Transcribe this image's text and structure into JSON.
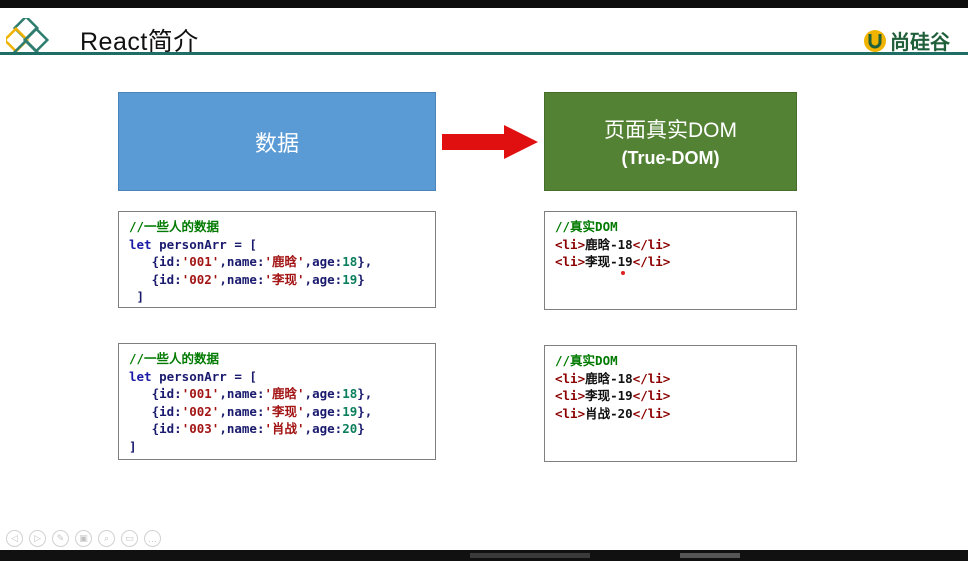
{
  "header": {
    "title": "React简介",
    "brand": "尚硅谷"
  },
  "diagram": {
    "source_label": "数据",
    "target_label_1": "页面真实DOM",
    "target_label_2": "(True-DOM)"
  },
  "code_a": {
    "comment": "//一些人的数据",
    "let": "let",
    "decl": " personArr = [",
    "rows": [
      {
        "id": "'001'",
        "name": "'鹿晗'",
        "age": "18"
      },
      {
        "id": "'002'",
        "name": "'李现'",
        "age": "19"
      }
    ],
    "close": " ]"
  },
  "code_b": {
    "comment": "//真实DOM",
    "items": [
      "鹿晗-18",
      "李现-19"
    ]
  },
  "code_c": {
    "comment": "//一些人的数据",
    "let": "let",
    "decl": " personArr = [",
    "rows": [
      {
        "id": "'001'",
        "name": "'鹿晗'",
        "age": "18"
      },
      {
        "id": "'002'",
        "name": "'李现'",
        "age": "19"
      },
      {
        "id": "'003'",
        "name": "'肖战'",
        "age": "20"
      }
    ],
    "close": "]"
  },
  "code_d": {
    "comment": "//真实DOM",
    "items": [
      "鹿晗-18",
      "李现-19",
      "肖战-20"
    ]
  },
  "syntax": {
    "indent": "   ",
    "open": "{id:",
    "name_key": ",name:",
    "age_key": ",age:",
    "row_close": "},",
    "last_close": "}",
    "li_open": "<li>",
    "li_close": "</li>"
  },
  "toolbar": {
    "buttons": [
      "◁",
      "▷",
      "✎",
      "▣",
      "⌕",
      "▭",
      "…"
    ]
  },
  "colors": {
    "header_line": "#1f6e66",
    "source_box": "#5b9bd5",
    "target_box": "#548235",
    "arrow": "#e01010"
  }
}
